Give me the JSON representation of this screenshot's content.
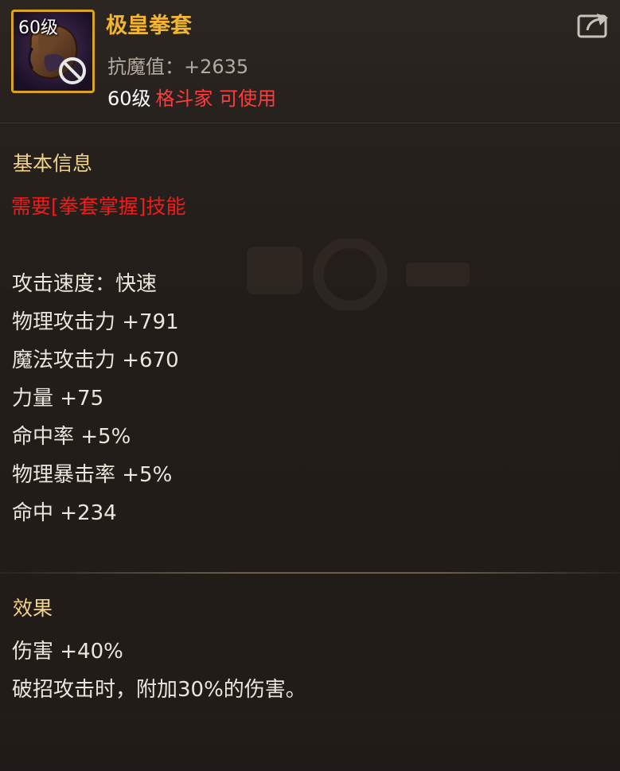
{
  "item": {
    "icon_level": "60级",
    "name": "极皇拳套",
    "resist": "抗魔值：+2635",
    "req_level": "60级",
    "req_class": "格斗家 可使用"
  },
  "icons": {
    "item_icon": "gauntlet-icon",
    "share": "share-icon",
    "forbidden": "forbidden-icon"
  },
  "colors": {
    "name": "#f2b531",
    "warning": "#f21b1b",
    "section": "#f1d28a",
    "frame": "#d9a521"
  },
  "basic": {
    "title": "基本信息",
    "requirement": "需要[拳套掌握]技能",
    "stats": [
      "攻击速度：快速",
      "物理攻击力 +791",
      "魔法攻击力 +670",
      "力量 +75",
      "命中率 +5%",
      "物理暴击率 +5%",
      "命中 +234"
    ]
  },
  "effect": {
    "title": "效果",
    "lines": [
      "伤害 +40%",
      "破招攻击时，附加30%的伤害。"
    ]
  }
}
